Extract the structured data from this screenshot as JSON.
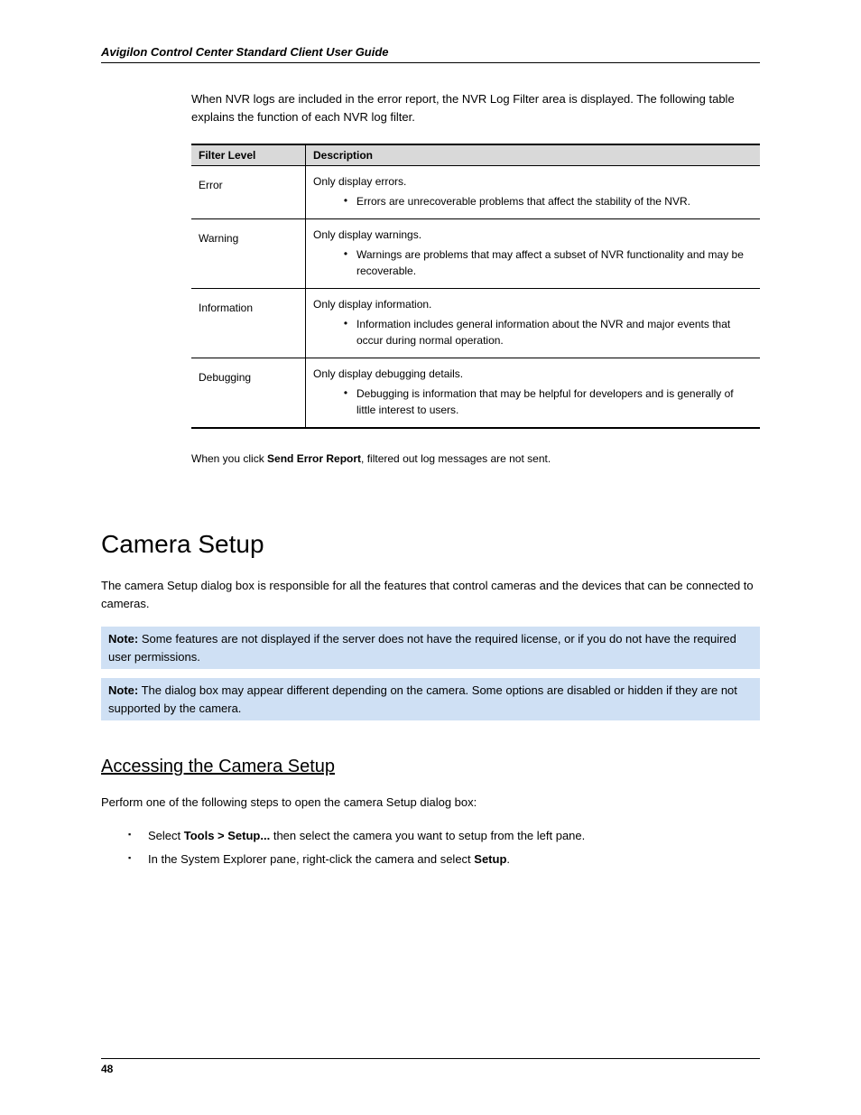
{
  "header": {
    "running_title": "Avigilon Control Center Standard Client User Guide"
  },
  "intro": "When NVR logs are included in the error report, the NVR Log Filter area is displayed. The following table explains the function of each NVR log filter.",
  "table": {
    "headers": {
      "level": "Filter Level",
      "desc": "Description"
    },
    "rows": [
      {
        "level": "Error",
        "desc": "Only display errors.",
        "bullet": "Errors are unrecoverable problems that affect the stability of the NVR."
      },
      {
        "level": "Warning",
        "desc": "Only display warnings.",
        "bullet": "Warnings are problems that may affect a subset of NVR functionality and may be recoverable."
      },
      {
        "level": "Information",
        "desc": "Only display information.",
        "bullet": "Information includes general information about the NVR and major events that occur during normal operation."
      },
      {
        "level": "Debugging",
        "desc": "Only display debugging details.",
        "bullet": "Debugging is information that may be helpful for developers and is generally of little interest to users."
      }
    ]
  },
  "post_table_note": {
    "prefix": "When you click ",
    "bold": "Send Error Report",
    "suffix": ", filtered out log messages are not sent."
  },
  "section": {
    "heading": "Camera Setup",
    "para": "The camera Setup dialog box is responsible for all the features that control cameras and the devices that can be connected to cameras.",
    "note1": {
      "label": "Note:",
      "text": " Some features are not displayed if the server does not have the required license, or if you do not have the required user permissions."
    },
    "note2": {
      "label": "Note:",
      "text": " The dialog box may appear different depending on the camera. Some options are disabled or hidden if they are not supported by the camera."
    },
    "sub_heading": "Accessing the Camera Setup",
    "access_intro": "Perform one of the following steps to open the camera Setup dialog box:",
    "access_items": [
      {
        "prefix": "Select ",
        "bold": "Tools > Setup...",
        "suffix": " then select the camera you want to setup from the left pane."
      },
      {
        "prefix": "In the System Explorer pane, right-click the camera and select ",
        "bold": "Setup",
        "suffix": "."
      }
    ]
  },
  "footer": {
    "page_number": "48"
  }
}
